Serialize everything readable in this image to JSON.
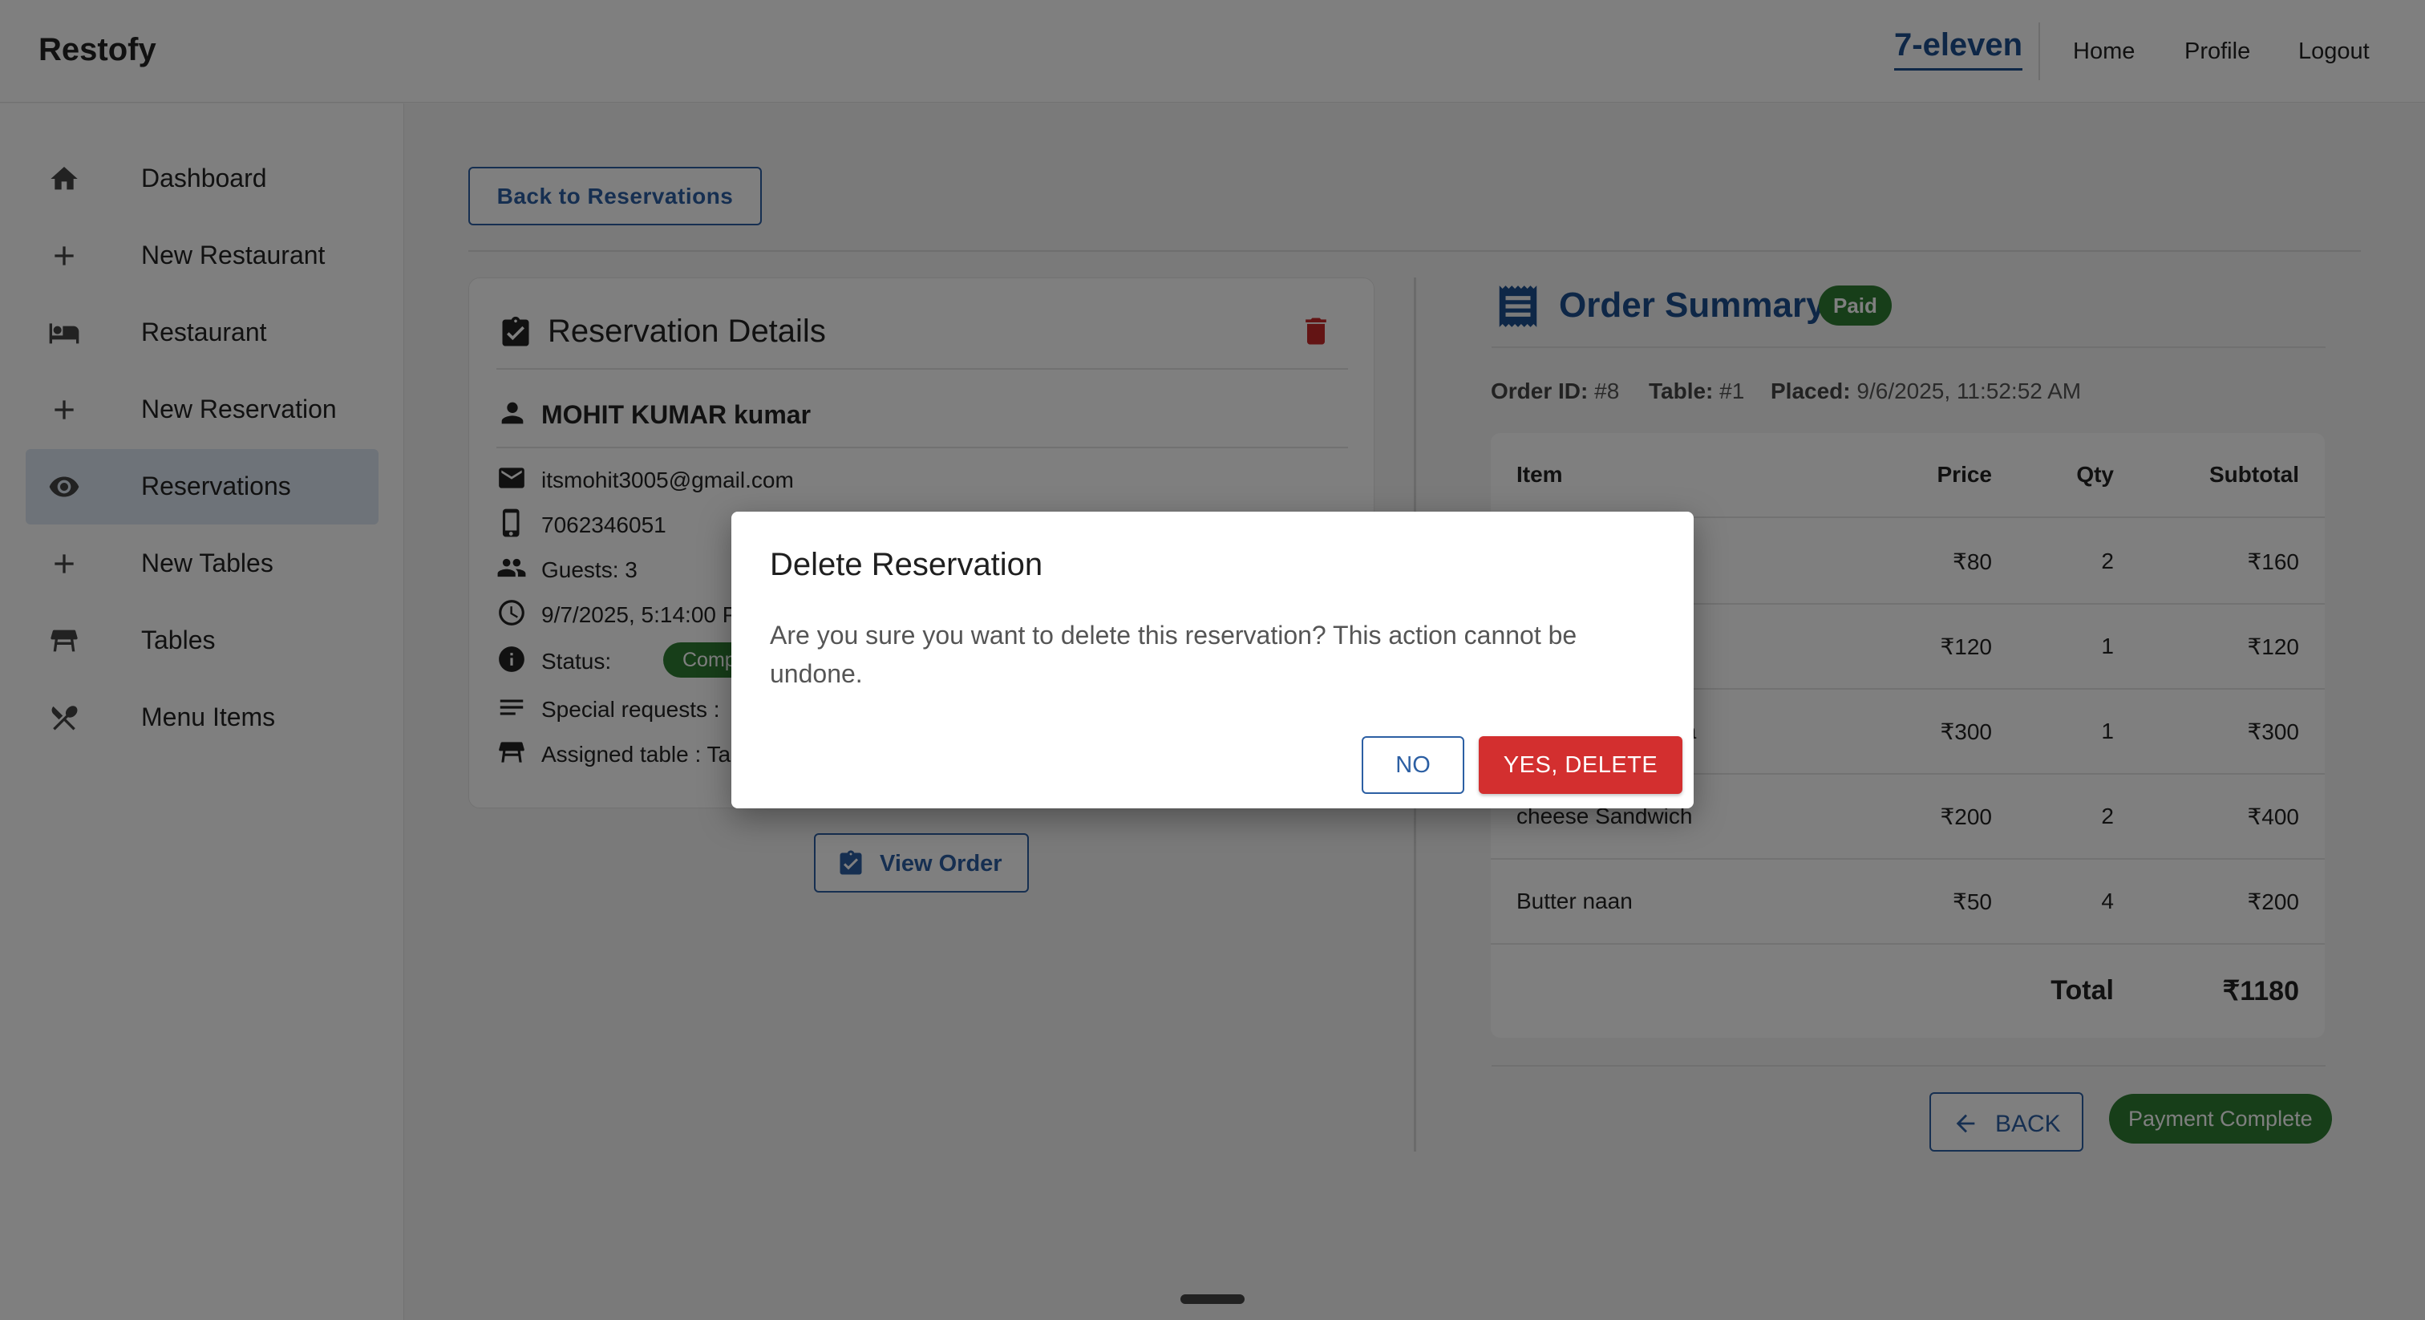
{
  "app": {
    "brand": "Restofy"
  },
  "topnav": {
    "store": "7-eleven",
    "home": "Home",
    "profile": "Profile",
    "logout": "Logout"
  },
  "sidebar": {
    "items": [
      {
        "label": "Dashboard",
        "icon": "home-icon"
      },
      {
        "label": "New Restaurant",
        "icon": "plus-icon"
      },
      {
        "label": "Restaurant",
        "icon": "bed-icon"
      },
      {
        "label": "New Reservation",
        "icon": "plus-icon"
      },
      {
        "label": "Reservations",
        "icon": "eye-icon",
        "active": true
      },
      {
        "label": "New Tables",
        "icon": "plus-icon"
      },
      {
        "label": "Tables",
        "icon": "table-icon"
      },
      {
        "label": "Menu Items",
        "icon": "utensils-icon"
      }
    ]
  },
  "main": {
    "back_to_reservations": "Back to Reservations",
    "reservation": {
      "title": "Reservation Details",
      "name": "MOHIT KUMAR kumar",
      "email": "itsmohit3005@gmail.com",
      "phone": "7062346051",
      "guests": "Guests: 3",
      "datetime": "9/7/2025, 5:14:00 P",
      "status_label": "Status:",
      "status_value": "Completed",
      "special_requests": "Special requests : ",
      "assigned_table": "Assigned table : Ta"
    },
    "view_order": "View Order",
    "order_summary": {
      "title": "Order Summary",
      "badge": "Paid",
      "order_id_label": "Order ID:",
      "order_id": "#8",
      "table_label": "Table:",
      "table": "#1",
      "placed_label": "Placed:",
      "placed": "9/6/2025, 11:52:52 AM",
      "columns": [
        "Item",
        "Price",
        "Qty",
        "Subtotal"
      ],
      "rows": [
        {
          "item": "",
          "price": "₹80",
          "qty": "2",
          "subtotal": "₹160"
        },
        {
          "item": "",
          "price": "₹120",
          "qty": "1",
          "subtotal": "₹120"
        },
        {
          "item": "sala",
          "price": "₹300",
          "qty": "1",
          "subtotal": "₹300"
        },
        {
          "item": "cheese Sandwich",
          "price": "₹200",
          "qty": "2",
          "subtotal": "₹400"
        },
        {
          "item": "Butter naan",
          "price": "₹50",
          "qty": "4",
          "subtotal": "₹200"
        }
      ],
      "total_label": "Total",
      "total": "₹1180",
      "back": "BACK",
      "payment_status": "Payment Complete"
    }
  },
  "dialog": {
    "title": "Delete Reservation",
    "message": "Are you sure you want to delete this reservation? This action cannot be undone.",
    "no": "NO",
    "yes": "YES, DELETE"
  }
}
